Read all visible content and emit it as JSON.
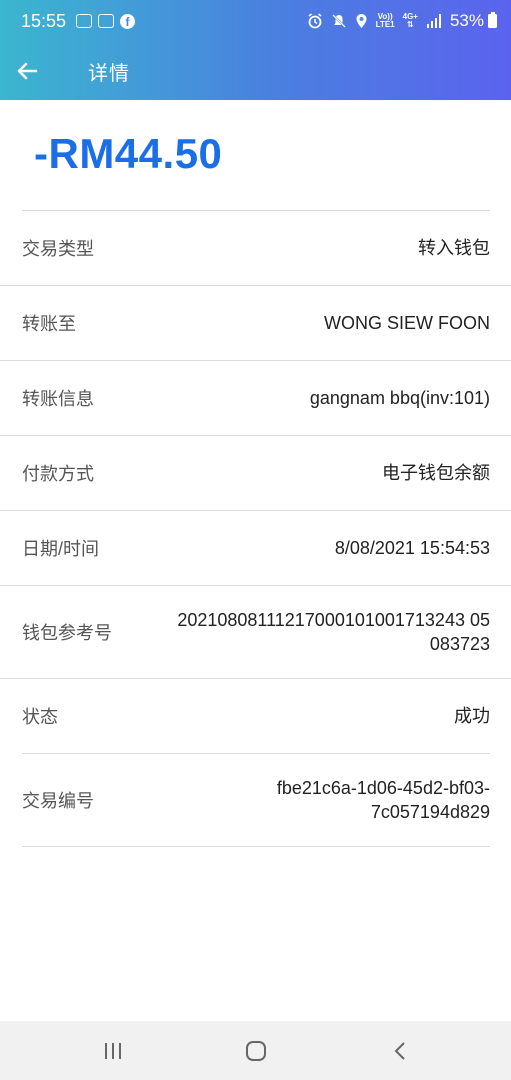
{
  "status_bar": {
    "time": "15:55",
    "network_label_top": "Vo))",
    "network_label_bottom": "LTE1",
    "network_gen": "4G+",
    "battery": "53%"
  },
  "app_bar": {
    "title": "详情"
  },
  "transaction": {
    "amount": "-RM44.50",
    "rows": [
      {
        "label": "交易类型",
        "value": "转入钱包"
      },
      {
        "label": "转账至",
        "value": "WONG SIEW FOON"
      },
      {
        "label": "转账信息",
        "value": "gangnam bbq(inv:101)"
      },
      {
        "label": "付款方式",
        "value": "电子钱包余额"
      },
      {
        "label": "日期/时间",
        "value": "8/08/2021 15:54:53"
      },
      {
        "label": "钱包参考号",
        "value_line1": "20210808111217000101001713243 05",
        "value_line2": "083723"
      },
      {
        "label": "状态",
        "value": "成功"
      },
      {
        "label": "交易编号",
        "value_line1": "fbe21c6a-1d06-45d2-bf03-",
        "value_line2": "7c057194d829"
      }
    ]
  },
  "colors": {
    "accent": "#1a6ee8",
    "header_gradient_start": "#3bb6cf",
    "header_gradient_end": "#5b63ee"
  },
  "icons": {
    "back": "arrow-left-icon",
    "nav_recents": "recents-icon",
    "nav_home": "home-icon",
    "nav_back": "chevron-left-icon"
  }
}
